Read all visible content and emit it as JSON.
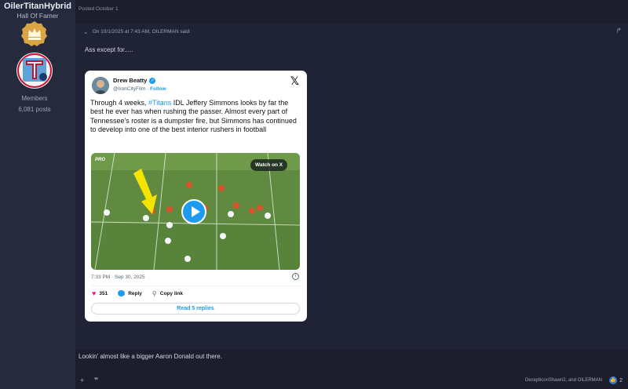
{
  "author": {
    "username": "OilerTitanHybrid",
    "title": "Hall Of Famer",
    "group": "Members",
    "posts": "6,081 posts"
  },
  "post": {
    "posted": "Posted October 1",
    "quote_header": "On 10/1/2025 at 7:43 AM, OILERMAN said:",
    "quote_text": "Ass except for.....",
    "reply_text": "Lookin' almost like a bigger Aaron Donald out there."
  },
  "tweet": {
    "name": "Drew Beatty",
    "handle": "@IronCityFilm",
    "separator": " · ",
    "follow": "Follow",
    "x_logo": "𝕏",
    "body_pre": "Through 4 weeks, ",
    "hashtag": "#Titans",
    "body_post": " IDL Jeffery Simmons looks by far the best he ever has when rushing the passer. Almost every part of Tennessee's roster is a dumpster fire, but Simmons has continued to develop into one of the best interior rushers in football",
    "media_logo": "PRO",
    "watch_label": "Watch on X",
    "timestamp": "7:33 PM · Sep 30, 2025",
    "likes": "351",
    "reply_label": "Reply",
    "copy_label": "Copy link",
    "replies_label": "Read 5 replies"
  },
  "footer": {
    "likers": "DecepticonShawn2, and OILERMAN",
    "reaction_count": "2"
  },
  "colors": {
    "background": "#1c1e2d",
    "sidebar": "#262a3d",
    "twitter_blue": "#1d9bf0",
    "like_pink": "#f91880"
  },
  "icons": [
    "badge-icon",
    "avatar",
    "chevron-down-icon",
    "share-icon",
    "verified-icon",
    "x-logo-icon",
    "play-icon",
    "info-icon",
    "heart-icon",
    "reply-icon",
    "link-icon",
    "plus-icon",
    "quote-icon",
    "reaction-icon"
  ]
}
